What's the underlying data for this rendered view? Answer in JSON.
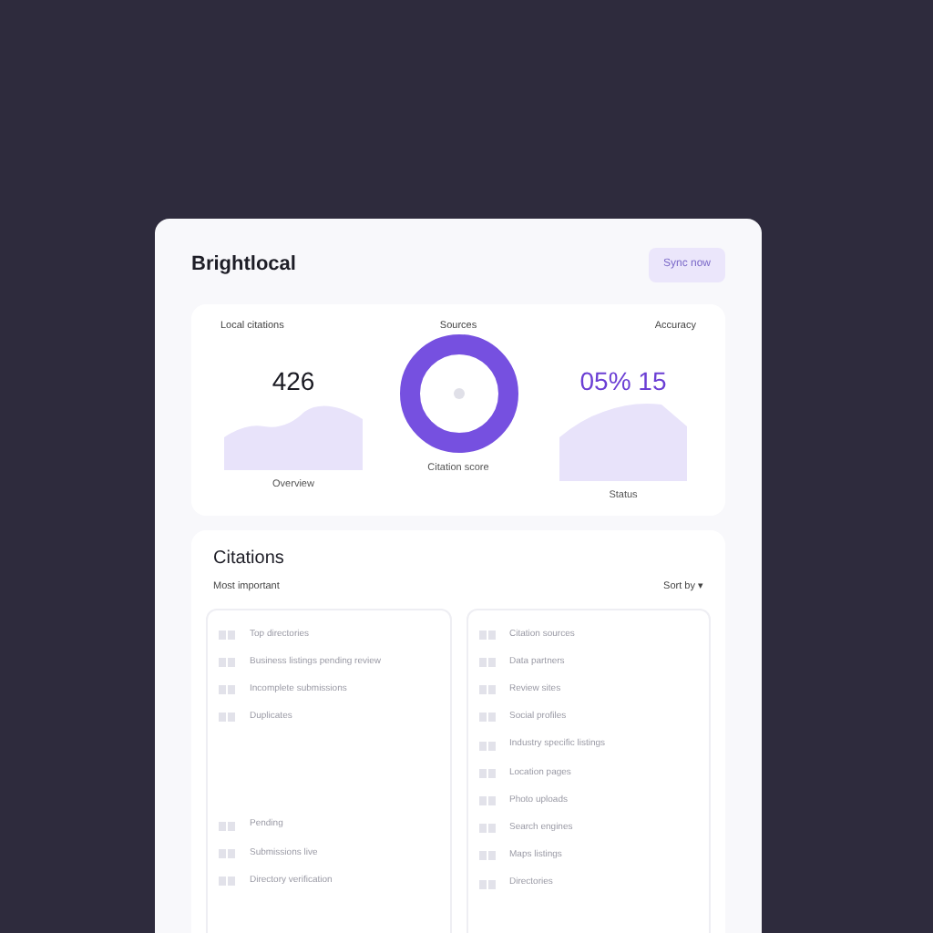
{
  "header": {
    "title": "Brightlocal",
    "button": "Sync now"
  },
  "stats": [
    {
      "kind": "area",
      "label": "Local citations",
      "value": "426",
      "caption": "Overview",
      "accent": false
    },
    {
      "kind": "donut",
      "label": "Sources",
      "caption": "Citation score"
    },
    {
      "kind": "area",
      "label": "Accuracy",
      "value": "05% 15",
      "caption": "Status",
      "accent": true
    }
  ],
  "citations": {
    "title": "Citations",
    "subtitle": "Most important",
    "sort": "Sort by ▾",
    "left_top": [
      "Top directories",
      "Business listings pending review",
      "Incomplete submissions",
      "Duplicates"
    ],
    "left_bottom": [
      "Pending",
      "Submissions live",
      "Directory verification"
    ],
    "right": [
      "Citation sources",
      "Data partners",
      "Review sites",
      "Social profiles",
      "Industry specific listings",
      "Location pages",
      "Photo uploads",
      "Search engines",
      "Maps listings",
      "Directories"
    ]
  }
}
